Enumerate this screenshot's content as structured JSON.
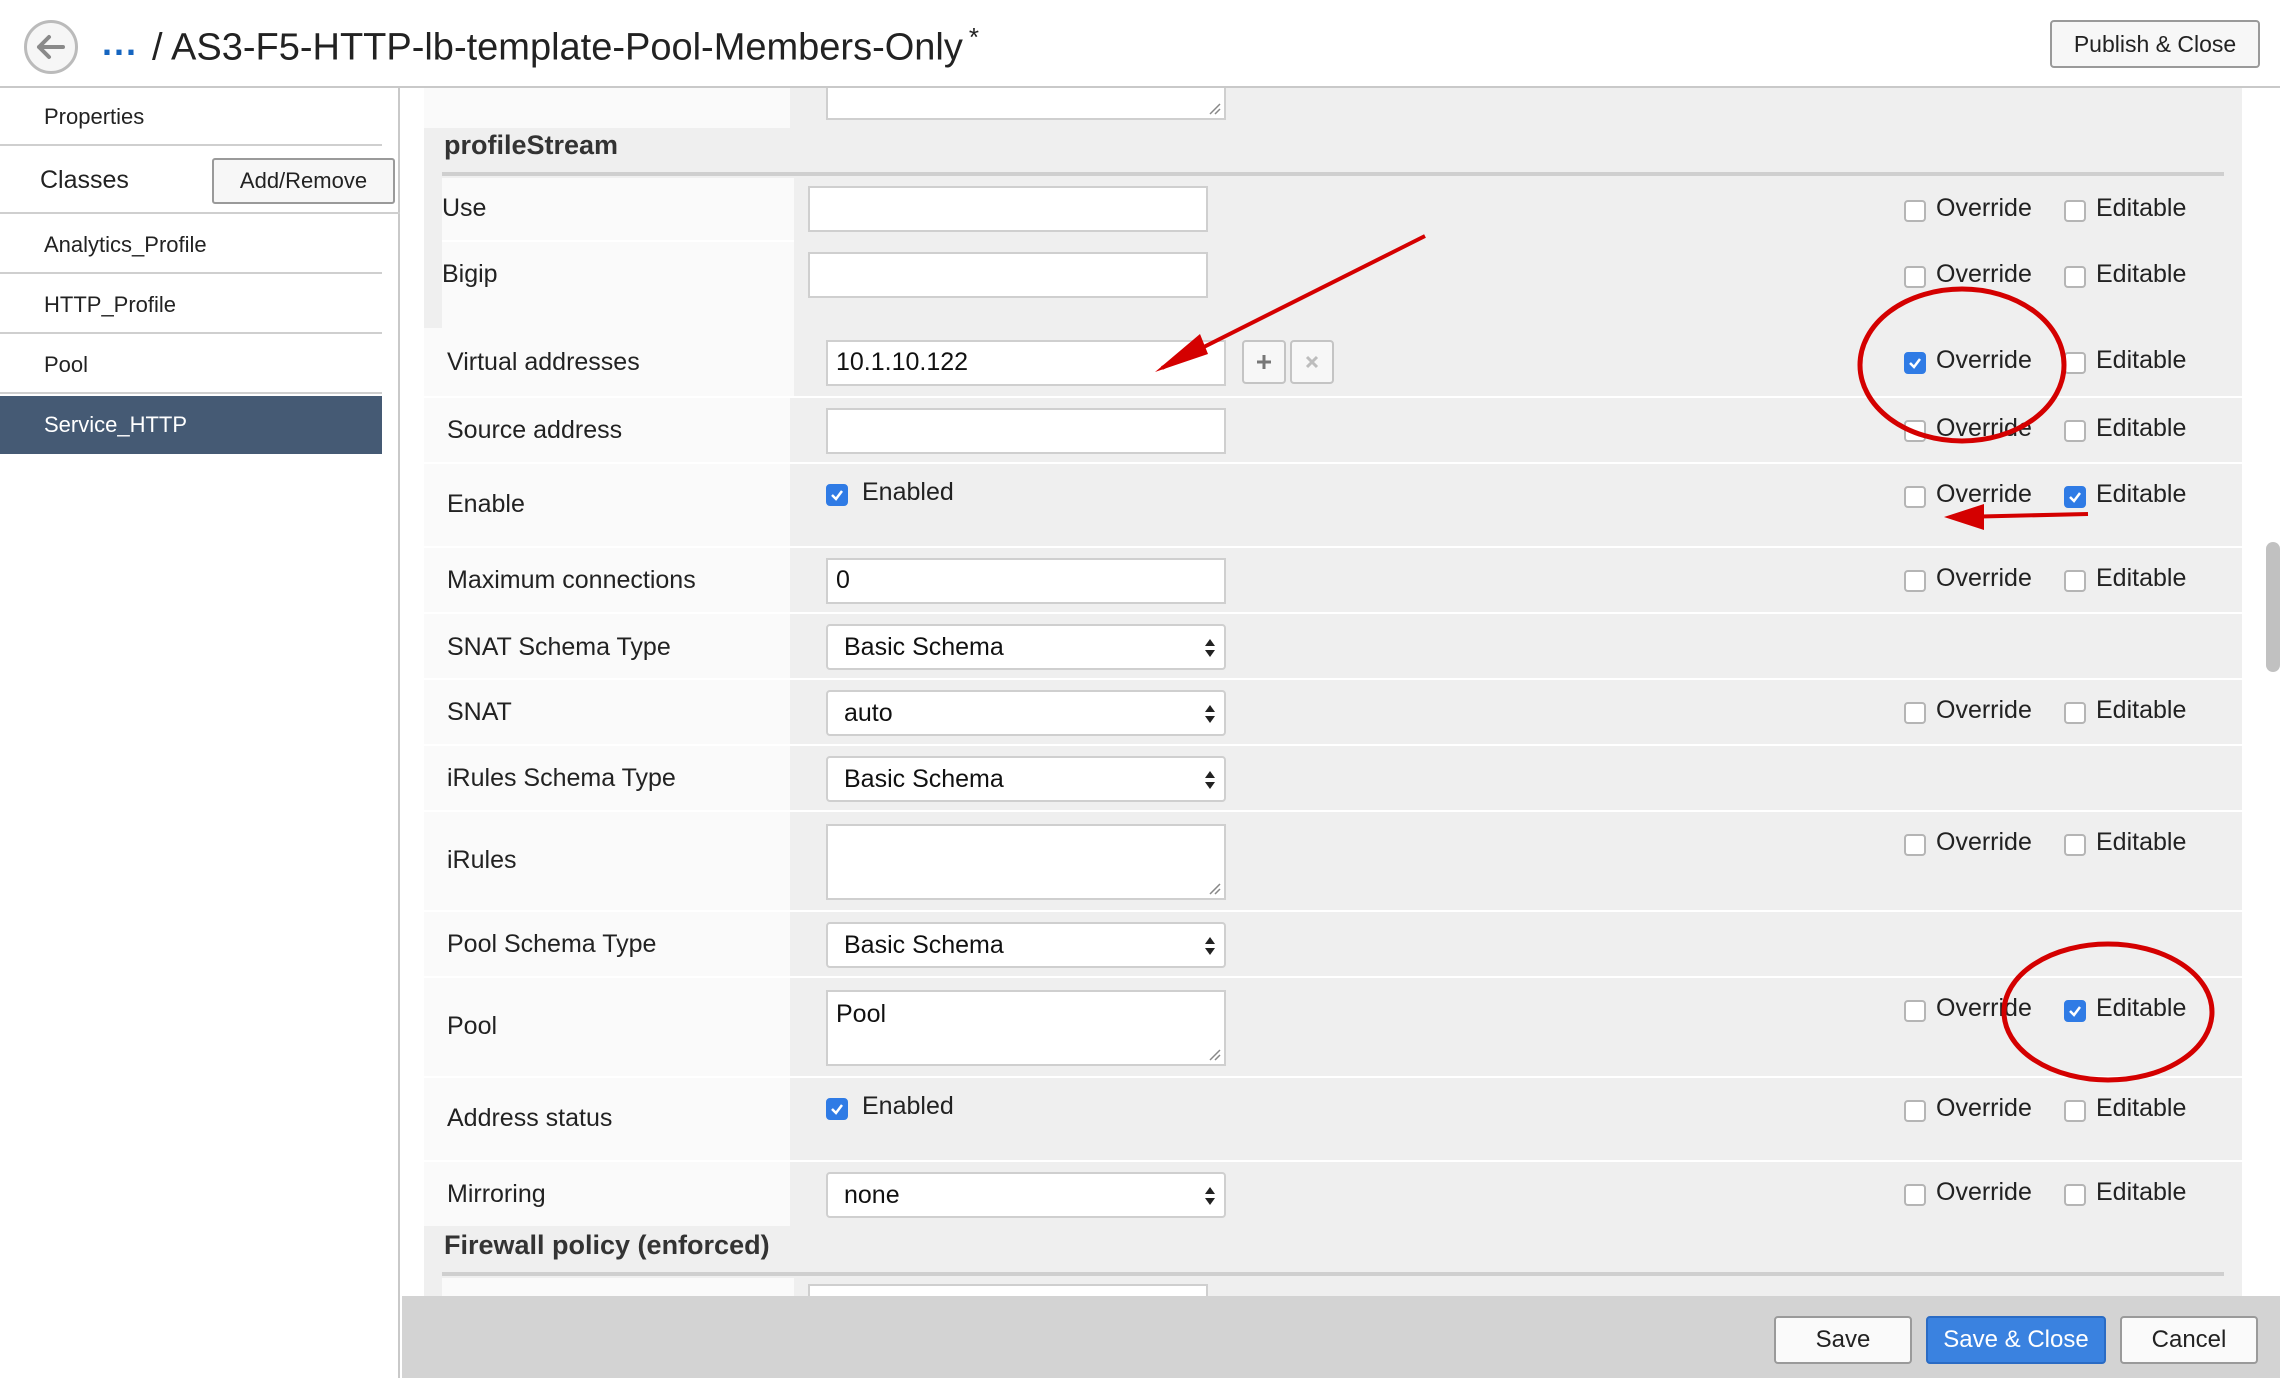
{
  "header": {
    "breadcrumb_ellipsis": "...",
    "title": "/ AS3-F5-HTTP-lb-template-Pool-Members-Only",
    "modified_marker": "*",
    "publish_close_label": "Publish & Close"
  },
  "sidebar": {
    "properties_label": "Properties",
    "classes_label": "Classes",
    "add_remove_label": "Add/Remove",
    "items": [
      {
        "label": "Analytics_Profile",
        "active": false
      },
      {
        "label": "HTTP_Profile",
        "active": false
      },
      {
        "label": "Pool",
        "active": false
      },
      {
        "label": "Service_HTTP",
        "active": true
      }
    ]
  },
  "profile_stream": {
    "section_title": "profileStream",
    "use_label": "Use",
    "use_value": "",
    "bigip_label": "Bigip",
    "bigip_value": "",
    "use_override": false,
    "use_editable": false,
    "bigip_override": false,
    "bigip_editable": false
  },
  "fields": {
    "virtual_addresses": {
      "label": "Virtual addresses",
      "value": "10.1.10.122",
      "override": true,
      "editable": false
    },
    "source_address": {
      "label": "Source address",
      "value": "",
      "override": false,
      "editable": false
    },
    "enable": {
      "label": "Enable",
      "checkbox_label": "Enabled",
      "checked": true,
      "override": false,
      "editable": true
    },
    "max_connections": {
      "label": "Maximum connections",
      "value": "0",
      "override": false,
      "editable": false
    },
    "snat_schema_type": {
      "label": "SNAT Schema Type",
      "value": "Basic Schema"
    },
    "snat": {
      "label": "SNAT",
      "value": "auto",
      "override": false,
      "editable": false
    },
    "irules_schema_type": {
      "label": "iRules Schema Type",
      "value": "Basic Schema"
    },
    "irules": {
      "label": "iRules",
      "value": "",
      "override": false,
      "editable": false
    },
    "pool_schema_type": {
      "label": "Pool Schema Type",
      "value": "Basic Schema"
    },
    "pool": {
      "label": "Pool",
      "value": "Pool",
      "override": false,
      "editable": true
    },
    "address_status": {
      "label": "Address status",
      "checkbox_label": "Enabled",
      "checked": true,
      "override": false,
      "editable": false
    },
    "mirroring": {
      "label": "Mirroring",
      "value": "none",
      "override": false,
      "editable": false
    }
  },
  "option_labels": {
    "override": "Override",
    "editable": "Editable"
  },
  "firewall": {
    "section_title": "Firewall policy (enforced)"
  },
  "footer": {
    "save_label": "Save",
    "save_close_label": "Save & Close",
    "cancel_label": "Cancel"
  },
  "colors": {
    "accent": "#3a82e0",
    "sidebar_active": "#455a74",
    "annotation_red": "#d40000",
    "link": "#1565c0"
  },
  "icons": {
    "back": "arrow-left-icon",
    "add": "plus-icon",
    "remove": "x-icon",
    "select": "updown-arrows-icon",
    "resize": "resize-grip-icon"
  }
}
